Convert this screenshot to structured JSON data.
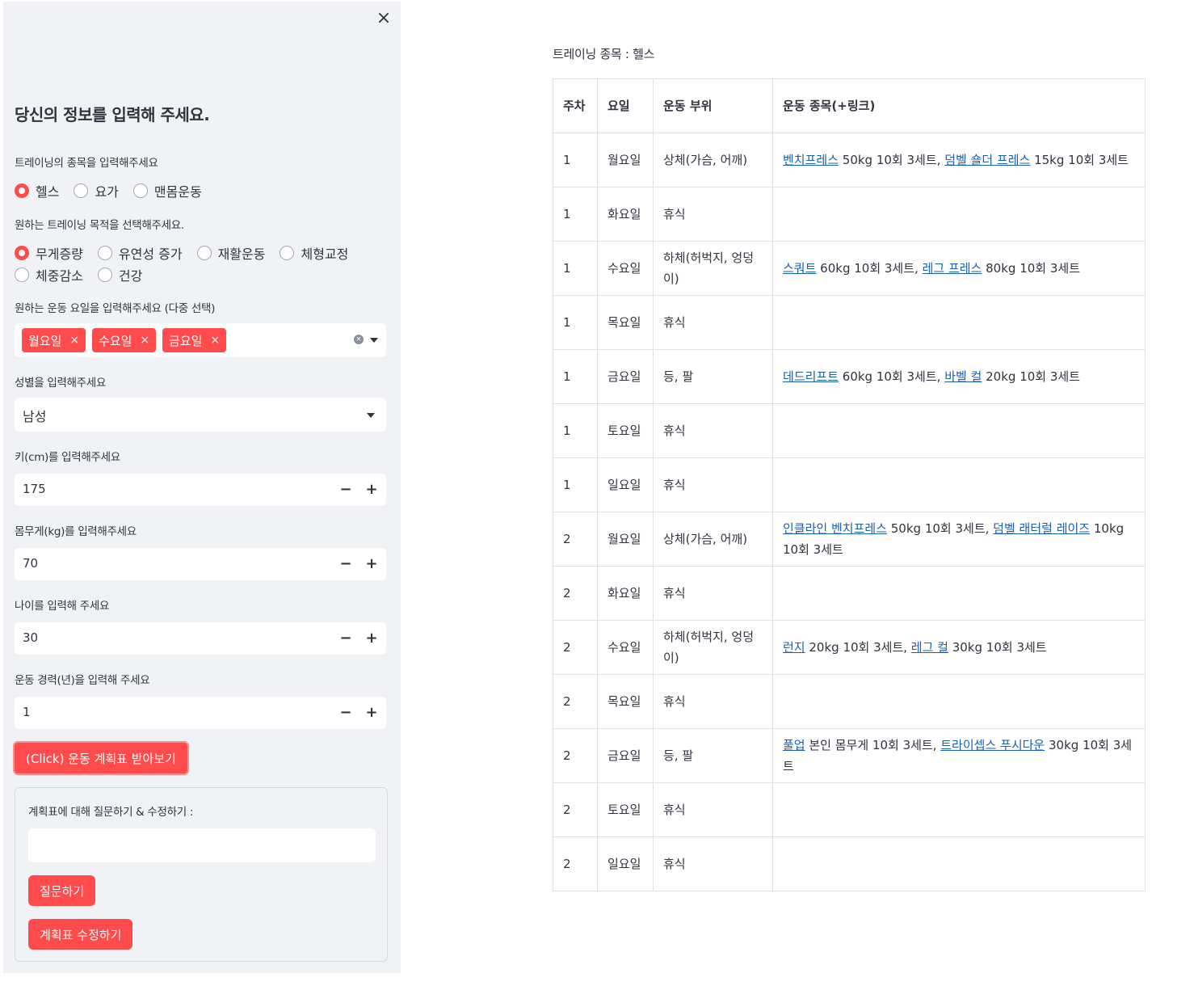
{
  "sidebar": {
    "close": "×",
    "title": "당신의 정보를 입력해 주세요.",
    "training_type": {
      "label": "트레이닝의 종목을 입력해주세요",
      "options": [
        "헬스",
        "요가",
        "맨몸운동"
      ],
      "selected": "헬스"
    },
    "goal": {
      "label": "원하는 트레이닝 목적을 선택해주세요.",
      "options": [
        "무게증량",
        "유연성 증가",
        "재활운동",
        "체형교정",
        "체중감소",
        "건강"
      ],
      "selected": "무게증량"
    },
    "days": {
      "label": "원하는 운동 요일을 입력해주세요 (다중 선택)",
      "selected": [
        "월요일",
        "수요일",
        "금요일"
      ],
      "remove": "×",
      "clear": "×"
    },
    "gender": {
      "label": "성별을 입력해주세요",
      "value": "남성"
    },
    "height": {
      "label": "키(cm)를 입력해주세요",
      "value": "175"
    },
    "weight": {
      "label": "몸무게(kg)를 입력해주세요",
      "value": "70"
    },
    "age": {
      "label": "나이를 입력해 주세요",
      "value": "30"
    },
    "experience": {
      "label": "운동 경력(년)을 입력해 주세요",
      "value": "1"
    },
    "stepper": {
      "minus": "−",
      "plus": "+"
    },
    "submit_button": "(Click) 운동 계획표 받아보기",
    "qa": {
      "label": "계획표에 대해 질문하기 & 수정하기 :",
      "input_value": "",
      "ask_button": "질문하기",
      "edit_button": "계획표 수정하기"
    }
  },
  "main": {
    "caption": "트레이닝 종목 : 헬스",
    "table": {
      "headers": [
        "주차",
        "요일",
        "운동 부위",
        "운동 종목(+링크)"
      ],
      "rows": [
        {
          "week": "1",
          "day": "월요일",
          "part": "상체(가슴, 어깨)",
          "items": [
            [
              "벤치프레스",
              " 50kg 10회 3세트, "
            ],
            [
              "덤벨 숄더 프레스",
              " 15kg 10회 3세트"
            ]
          ]
        },
        {
          "week": "1",
          "day": "화요일",
          "part": "휴식",
          "items": []
        },
        {
          "week": "1",
          "day": "수요일",
          "part": "하체(허벅지, 엉덩이)",
          "items": [
            [
              "스쿼트",
              " 60kg 10회 3세트, "
            ],
            [
              "레그 프레스",
              " 80kg 10회 3세트"
            ]
          ]
        },
        {
          "week": "1",
          "day": "목요일",
          "part": "휴식",
          "items": []
        },
        {
          "week": "1",
          "day": "금요일",
          "part": "등, 팔",
          "items": [
            [
              "데드리프트",
              " 60kg 10회 3세트, "
            ],
            [
              "바벨 컬",
              " 20kg 10회 3세트"
            ]
          ]
        },
        {
          "week": "1",
          "day": "토요일",
          "part": "휴식",
          "items": []
        },
        {
          "week": "1",
          "day": "일요일",
          "part": "휴식",
          "items": []
        },
        {
          "week": "2",
          "day": "월요일",
          "part": "상체(가슴, 어깨)",
          "items": [
            [
              "인클라인 벤치프레스",
              " 50kg 10회 3세트, "
            ],
            [
              "덤벨 래터럴 레이즈",
              " 10kg 10회 3세트"
            ]
          ]
        },
        {
          "week": "2",
          "day": "화요일",
          "part": "휴식",
          "items": []
        },
        {
          "week": "2",
          "day": "수요일",
          "part": "하체(허벅지, 엉덩이)",
          "items": [
            [
              "런지",
              " 20kg 10회 3세트, "
            ],
            [
              "레그 컬",
              " 30kg 10회 3세트"
            ]
          ]
        },
        {
          "week": "2",
          "day": "목요일",
          "part": "휴식",
          "items": []
        },
        {
          "week": "2",
          "day": "금요일",
          "part": "등, 팔",
          "items": [
            [
              "풀업",
              " 본인 몸무게 10회 3세트, "
            ],
            [
              "트라이셉스 푸시다운",
              " 30kg 10회 3세트"
            ]
          ]
        },
        {
          "week": "2",
          "day": "토요일",
          "part": "휴식",
          "items": []
        },
        {
          "week": "2",
          "day": "일요일",
          "part": "휴식",
          "items": []
        }
      ]
    }
  },
  "colors": {
    "accent": "#ff4b4b",
    "sidebar_bg": "#f0f2f6",
    "link": "#1a5fb4"
  }
}
